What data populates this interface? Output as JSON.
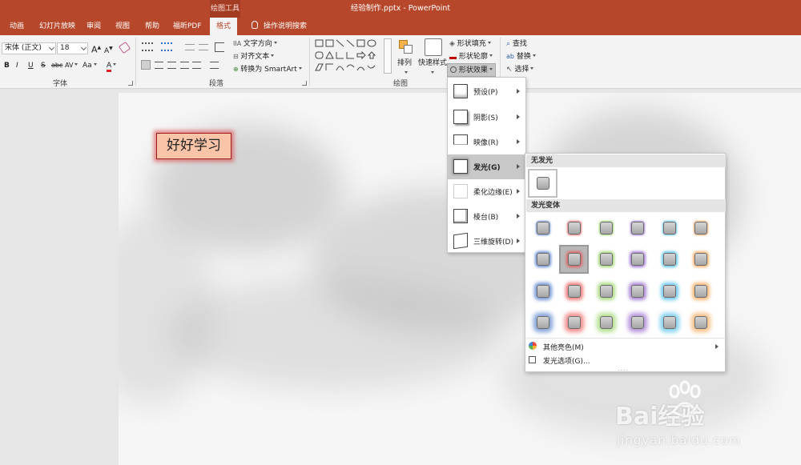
{
  "window": {
    "title": "经验制作.pptx  -  PowerPoint",
    "context_tab_group": "绘图工具"
  },
  "tabs": [
    {
      "label": "动画",
      "active": false
    },
    {
      "label": "幻灯片放映",
      "active": false
    },
    {
      "label": "审阅",
      "active": false
    },
    {
      "label": "视图",
      "active": false
    },
    {
      "label": "帮助",
      "active": false
    },
    {
      "label": "福昕PDF",
      "active": false
    },
    {
      "label": "格式",
      "active": true
    }
  ],
  "tell_me": "操作说明搜索",
  "ribbon": {
    "font": {
      "font_name": "宋体 (正文)",
      "font_size": "18",
      "group_label": "字体",
      "grow": "A",
      "shrink": "A",
      "bold": "B",
      "italic": "I",
      "underline": "U",
      "strike": "S",
      "char_spacing": "AV",
      "change_case": "Aa",
      "font_color": "A",
      "abc": "abc"
    },
    "paragraph": {
      "group_label": "段落",
      "text_direction": "文字方向",
      "align_text": "对齐文本",
      "convert_smartart": "转换为 SmartArt"
    },
    "drawing": {
      "group_label": "绘图",
      "arrange": "排列",
      "quick_styles": "快速样式",
      "shape_fill": "形状填充",
      "shape_outline": "形状轮廓",
      "shape_effects": "形状效果"
    },
    "editing": {
      "find": "查找",
      "replace": "替换",
      "select": "选择"
    }
  },
  "slide": {
    "textbox_text": "好好学习"
  },
  "effects_menu": {
    "items": [
      {
        "label": "预设(P)",
        "hover": false
      },
      {
        "label": "阴影(S)",
        "hover": false
      },
      {
        "label": "映像(R)",
        "hover": false
      },
      {
        "label": "发光(G)",
        "hover": true
      },
      {
        "label": "柔化边缘(E)",
        "hover": false
      },
      {
        "label": "棱台(B)",
        "hover": false
      },
      {
        "label": "三维旋转(D)",
        "hover": false
      }
    ]
  },
  "glow_menu": {
    "no_glow_heading": "无发光",
    "variations_heading": "发光变体",
    "colors": [
      "#4472c4",
      "#ed4f4f",
      "#8fd05a",
      "#8e5cc9",
      "#3fb8e6",
      "#f5a04a"
    ],
    "selected": {
      "row": 1,
      "col": 1
    },
    "more_colors": "其他亮色(M)",
    "glow_options": "发光选项(G)..."
  },
  "watermark": {
    "brand": "Bai",
    "brand_tail": "经验",
    "url": "jingyan.baidu.com"
  }
}
